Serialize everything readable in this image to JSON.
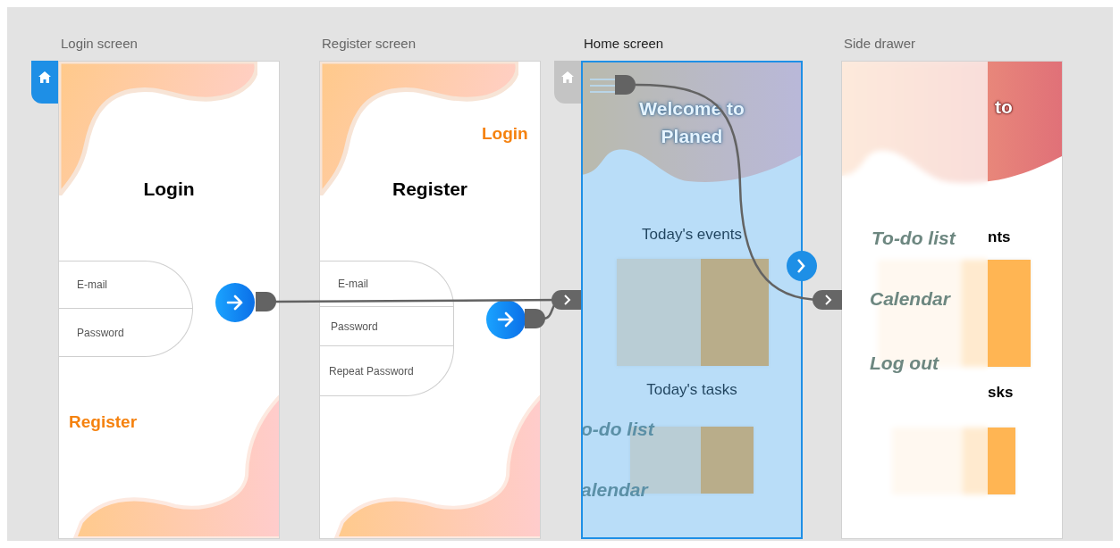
{
  "artboards": [
    {
      "kind": "login",
      "label": "Login screen",
      "home_tab": {
        "color": "#1e8fe6"
      },
      "selected": false,
      "title": "Login",
      "fields": [
        {
          "placeholder": "E-mail"
        },
        {
          "placeholder": "Password"
        }
      ],
      "link": "Register"
    },
    {
      "kind": "register",
      "label": "Register screen",
      "selected": false,
      "link": "Login",
      "title": "Register",
      "fields": [
        {
          "placeholder": "E-mail"
        },
        {
          "placeholder": "Password"
        },
        {
          "placeholder": "Repeat Password"
        }
      ]
    },
    {
      "kind": "home",
      "label": "Home screen",
      "home_tab": {
        "color": "#c4c4c4"
      },
      "selected": true,
      "welcome": "Welcome to Planed",
      "events_heading": "Today's events",
      "tasks_heading": "Today's tasks",
      "drawer_items": [
        "o-do list",
        "alendar"
      ]
    },
    {
      "kind": "drawer",
      "label": "Side drawer",
      "selected": false,
      "welcome": "to",
      "events_heading": "nts",
      "tasks_heading": "sks",
      "drawer_items": [
        "To-do list",
        "Calendar",
        "Log out"
      ]
    }
  ]
}
